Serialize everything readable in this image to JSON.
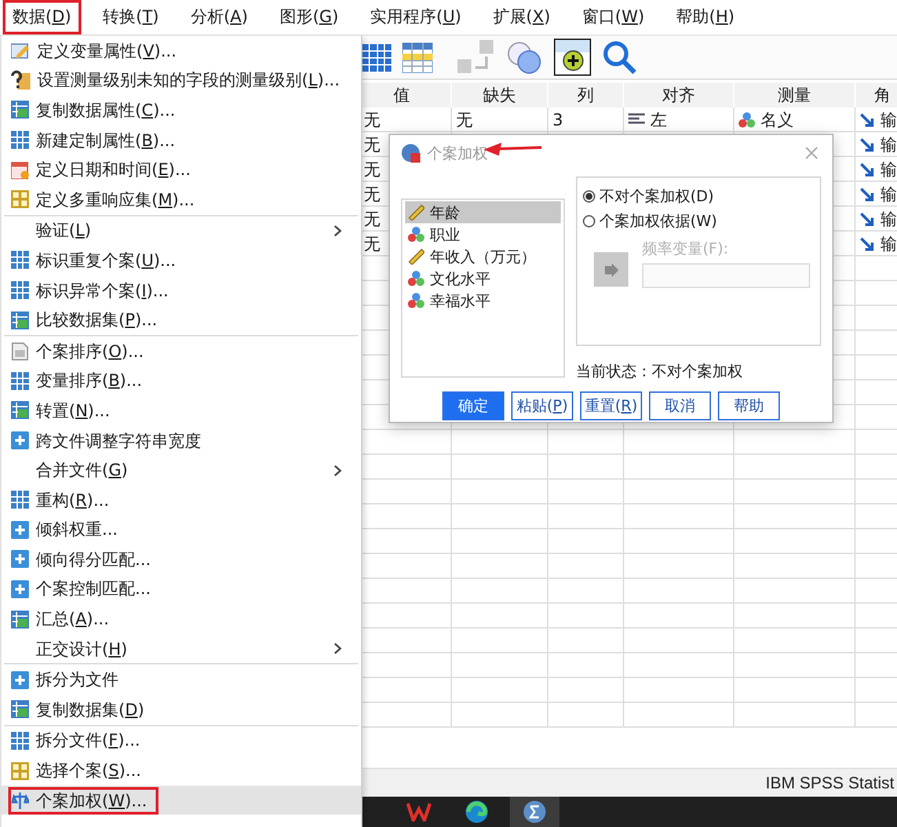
{
  "menubar": [
    {
      "label": "数据(D)",
      "annotated": true
    },
    {
      "label": "转换(T)",
      "annotated": false
    },
    {
      "label": "分析(A)",
      "annotated": false
    },
    {
      "label": "图形(G)",
      "annotated": false
    },
    {
      "label": "实用程序(U)",
      "annotated": false
    },
    {
      "label": "扩展(X)",
      "annotated": false
    },
    {
      "label": "窗口(W)",
      "annotated": false
    },
    {
      "label": "帮助(H)",
      "annotated": false
    }
  ],
  "data_grid": {
    "columns": [
      "值",
      "缺失",
      "列",
      "对齐",
      "测量",
      "角"
    ],
    "rows": [
      {
        "value": "无",
        "missing": "无",
        "column": "3",
        "align": "左",
        "measure": "名义",
        "role": "输"
      },
      {
        "value": "无",
        "role": "输"
      },
      {
        "value": "无",
        "role": "输"
      },
      {
        "value": "无",
        "role": "输"
      },
      {
        "value": "无",
        "role": "输"
      },
      {
        "value": "无",
        "role": "输"
      }
    ]
  },
  "data_menu": {
    "items": [
      {
        "kind": "command",
        "label": "定义变量属性(V)...",
        "selected": false,
        "annotated": false
      },
      {
        "kind": "command",
        "label": "设置测量级别未知的字段的测量级别(L)...",
        "selected": false,
        "annotated": false
      },
      {
        "kind": "command",
        "label": "复制数据属性(C)...",
        "selected": false,
        "annotated": false
      },
      {
        "kind": "command",
        "label": "新建定制属性(B)...",
        "selected": false,
        "annotated": false
      },
      {
        "kind": "command",
        "label": "定义日期和时间(E)...",
        "selected": false,
        "annotated": false
      },
      {
        "kind": "command",
        "label": "定义多重响应集(M)...",
        "selected": false,
        "annotated": false
      },
      {
        "kind": "separator"
      },
      {
        "kind": "submenu",
        "label": "验证(L)",
        "selected": false,
        "annotated": false
      },
      {
        "kind": "command",
        "label": "标识重复个案(U)...",
        "selected": false,
        "annotated": false
      },
      {
        "kind": "command",
        "label": "标识异常个案(I)...",
        "selected": false,
        "annotated": false
      },
      {
        "kind": "command",
        "label": "比较数据集(P)...",
        "selected": false,
        "annotated": false
      },
      {
        "kind": "separator"
      },
      {
        "kind": "command",
        "label": "个案排序(O)...",
        "selected": false,
        "annotated": false
      },
      {
        "kind": "command",
        "label": "变量排序(B)...",
        "selected": false,
        "annotated": false
      },
      {
        "kind": "command",
        "label": "转置(N)...",
        "selected": false,
        "annotated": false
      },
      {
        "kind": "command",
        "label": "跨文件调整字符串宽度",
        "selected": false,
        "annotated": false
      },
      {
        "kind": "submenu",
        "label": "合并文件(G)",
        "selected": false,
        "annotated": false
      },
      {
        "kind": "command",
        "label": "重构(R)...",
        "selected": false,
        "annotated": false
      },
      {
        "kind": "command",
        "label": "倾斜权重...",
        "selected": false,
        "annotated": false
      },
      {
        "kind": "command",
        "label": "倾向得分匹配...",
        "selected": false,
        "annotated": false
      },
      {
        "kind": "command",
        "label": "个案控制匹配...",
        "selected": false,
        "annotated": false
      },
      {
        "kind": "command",
        "label": "汇总(A)...",
        "selected": false,
        "annotated": false
      },
      {
        "kind": "submenu",
        "label": "正交设计(H)",
        "selected": false,
        "annotated": false
      },
      {
        "kind": "separator"
      },
      {
        "kind": "command",
        "label": "拆分为文件",
        "selected": false,
        "annotated": false
      },
      {
        "kind": "command",
        "label": "复制数据集(D)",
        "selected": false,
        "annotated": false
      },
      {
        "kind": "separator"
      },
      {
        "kind": "command",
        "label": "拆分文件(F)...",
        "selected": false,
        "annotated": false
      },
      {
        "kind": "command",
        "label": "选择个案(S)...",
        "selected": false,
        "annotated": false
      },
      {
        "kind": "command",
        "label": "个案加权(W)...",
        "selected": true,
        "annotated": true
      }
    ]
  },
  "dialog": {
    "title": "个案加权",
    "variables": [
      {
        "label": "年龄",
        "kind": "scale",
        "selected": true
      },
      {
        "label": "职业",
        "kind": "nominal",
        "selected": false
      },
      {
        "label": "年收入（万元）",
        "kind": "scale",
        "selected": false
      },
      {
        "label": "文化水平",
        "kind": "nominal",
        "selected": false
      },
      {
        "label": "幸福水平",
        "kind": "nominal",
        "selected": false
      }
    ],
    "weight_options": [
      {
        "label": "不对个案加权(D)",
        "selected": true
      },
      {
        "label": "个案加权依据(W)",
        "selected": false
      }
    ],
    "move_button": {
      "disabled": true
    },
    "frequency_variable": {
      "label": "频率变量(F):",
      "disabled": true
    },
    "status": "当前状态：不对个案加权",
    "buttons": [
      {
        "label": "确定",
        "primary": true
      },
      {
        "label": "粘贴(P)",
        "primary": false
      },
      {
        "label": "重置(R)",
        "primary": false
      },
      {
        "label": "取消",
        "primary": false
      },
      {
        "label": "帮助",
        "primary": false
      }
    ]
  },
  "status_bar": {
    "text": "IBM SPSS Statist"
  },
  "taskbar": {
    "apps": [
      {
        "kind": "office",
        "active": false
      },
      {
        "kind": "browser",
        "active": false
      },
      {
        "kind": "statistics",
        "active": true
      }
    ]
  }
}
